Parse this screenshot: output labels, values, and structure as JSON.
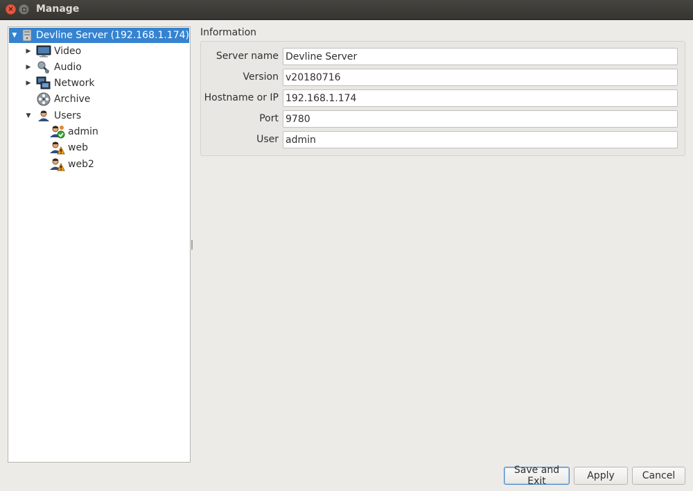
{
  "window": {
    "title": "Manage"
  },
  "tree": {
    "root": {
      "label": "Devline Server (192.168.1.174)",
      "icon": "server-icon",
      "expanded": true,
      "selected": true
    },
    "items": [
      {
        "label": "Video",
        "icon": "monitor-icon",
        "expandable": true,
        "expanded": false
      },
      {
        "label": "Audio",
        "icon": "microphone-icon",
        "expandable": true,
        "expanded": false
      },
      {
        "label": "Network",
        "icon": "network-icon",
        "expandable": true,
        "expanded": false
      },
      {
        "label": "Archive",
        "icon": "film-reel-icon",
        "expandable": false
      },
      {
        "label": "Users",
        "icon": "user-icon",
        "expandable": true,
        "expanded": true
      }
    ],
    "users": [
      {
        "label": "admin",
        "icon": "user-admin-icon"
      },
      {
        "label": "web",
        "icon": "user-warning-icon"
      },
      {
        "label": "web2",
        "icon": "user-warning-icon"
      }
    ]
  },
  "info": {
    "title": "Information",
    "fields": [
      {
        "label": "Server name",
        "value": "Devline Server"
      },
      {
        "label": "Version",
        "value": "v20180716"
      },
      {
        "label": "Hostname or IP",
        "value": "192.168.1.174"
      },
      {
        "label": "Port",
        "value": "9780"
      },
      {
        "label": "User",
        "value": "admin"
      }
    ]
  },
  "buttons": {
    "save_exit": "Save and Exit",
    "apply": "Apply",
    "cancel": "Cancel"
  },
  "colors": {
    "selection": "#3583d0",
    "titlebar": "#3c3b37",
    "close": "#e9573f"
  }
}
